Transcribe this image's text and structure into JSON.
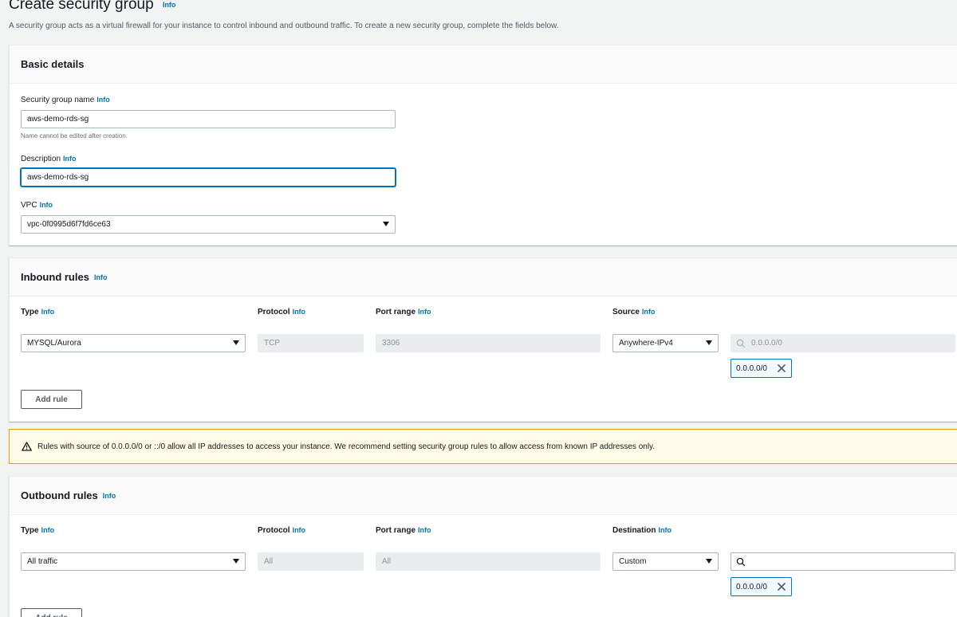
{
  "header": {
    "title": "Create security group",
    "title_info": "Info",
    "description": "A security group acts as a virtual firewall for your instance to control inbound and outbound traffic. To create a new security group, complete the fields below."
  },
  "basic": {
    "title": "Basic details",
    "name_label": "Security group name",
    "name_value": "aws-demo-rds-sg",
    "name_hint": "Name cannot be edited after creation.",
    "desc_label": "Description",
    "desc_value": "aws-demo-rds-sg",
    "vpc_label": "VPC",
    "vpc_value": "vpc-0f0995d6f7fd6ce63",
    "info": "Info"
  },
  "inbound": {
    "title": "Inbound rules",
    "info": "Info",
    "col_type": "Type",
    "col_protocol": "Protocol",
    "col_port": "Port range",
    "col_source": "Source",
    "rule": {
      "type": "MYSQL/Aurora",
      "protocol": "TCP",
      "port": "3306",
      "source": "Anywhere-IPv4",
      "cidr_placeholder": "0.0.0.0/0",
      "token": "0.0.0.0/0"
    },
    "add_rule": "Add rule"
  },
  "warning": {
    "text": "Rules with source of 0.0.0.0/0 or ::/0 allow all IP addresses to access your instance. We recommend setting security group rules to allow access from known IP addresses only."
  },
  "outbound": {
    "title": "Outbound rules",
    "info": "Info",
    "col_type": "Type",
    "col_protocol": "Protocol",
    "col_port": "Port range",
    "col_dest": "Destination",
    "rule": {
      "type": "All traffic",
      "protocol": "All",
      "port": "All",
      "dest": "Custom",
      "cidr_value": "",
      "token": "0.0.0.0/0"
    },
    "add_rule": "Add rule"
  },
  "colors": {
    "accent": "#0073bb",
    "warning_border": "#ff9900",
    "warning_bg": "#fffce8"
  }
}
